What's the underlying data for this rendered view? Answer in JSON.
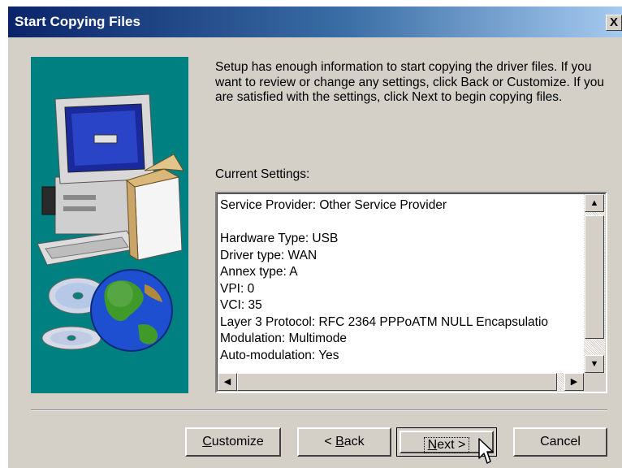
{
  "window": {
    "title": "Start Copying Files",
    "close_glyph": "X"
  },
  "intro_text": "Setup has enough information to start copying the driver files. If you want to review or change any settings, click Back or Customize.  If you are satisfied with the settings, click Next to begin copying files.",
  "settings_label": "Current Settings:",
  "settings_lines": [
    "Service Provider: Other Service Provider",
    "",
    "Hardware Type: USB",
    "Driver type: WAN",
    "Annex type: A",
    "VPI: 0",
    "VCI: 35",
    "Layer 3 Protocol: RFC 2364 PPPoATM NULL Encapsulatio",
    "Modulation: Multimode",
    "Auto-modulation: Yes"
  ],
  "buttons": {
    "customize_prefix": "",
    "customize_mnemonic": "C",
    "customize_rest": "ustomize",
    "back_prefix": "< ",
    "back_mnemonic": "B",
    "back_rest": "ack",
    "next_prefix": "",
    "next_mnemonic": "N",
    "next_rest": "ext >",
    "cancel": "Cancel"
  },
  "icons": [
    "computer-icon",
    "cd-disc-icon",
    "globe-icon",
    "scroll-up-arrow-icon",
    "scroll-down-arrow-icon",
    "scroll-left-arrow-icon",
    "scroll-right-arrow-icon",
    "mouse-pointer-icon"
  ],
  "colors": {
    "title_gradient_start": "#0a246a",
    "title_gradient_end": "#a6caf0",
    "dialog_face": "#d4d0c8",
    "art_background": "#008080"
  }
}
